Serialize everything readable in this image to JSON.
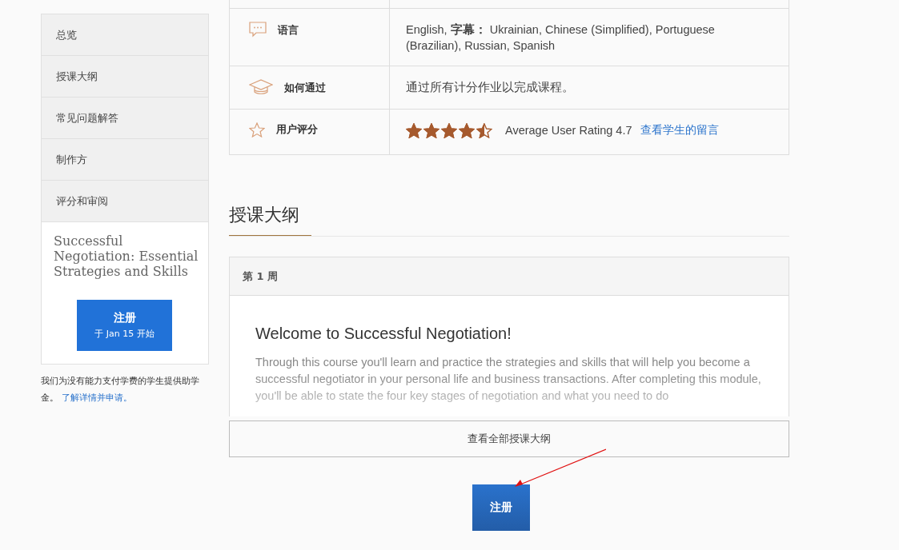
{
  "sidebar": {
    "items": [
      {
        "label": "总览"
      },
      {
        "label": "授课大纲"
      },
      {
        "label": "常见问题解答"
      },
      {
        "label": "制作方"
      },
      {
        "label": "评分和审阅"
      }
    ],
    "course_card": {
      "title": "Successful Negotiation: Essential Strategies and Skills",
      "enroll_button": {
        "label": "注册",
        "subtitle": "于 Jan 15 开始"
      }
    },
    "aid_note": {
      "text": "我们为没有能力支付学费的学生提供助学金。",
      "link": "了解详情并申请。"
    }
  },
  "info_table": {
    "rows": [
      {
        "kind": "language",
        "label": "语言",
        "value": "English, **字幕：** Ukrainian, Chinese (Simplified), Portuguese (Brazilian), Russian, Spanish"
      },
      {
        "kind": "pass",
        "label": "如何通过",
        "value": "通过所有计分作业以完成课程。"
      },
      {
        "kind": "rating",
        "label": "用户评分",
        "stars": 4.5,
        "value": "Average User Rating 4.7",
        "link": "查看学生的留言"
      }
    ]
  },
  "syllabus": {
    "heading": "授课大纲",
    "week": {
      "label": "第 1 周",
      "title": "Welcome to Successful Negotiation!",
      "description": "Through this course you'll learn and practice the strategies and skills that will help you become a successful negotiator in your personal life and business transactions. After completing this module, you'll be able to state the four key stages of negotiation and what you need to do"
    },
    "view_all_button": "查看全部授课大纲",
    "enroll_button": "注册"
  }
}
